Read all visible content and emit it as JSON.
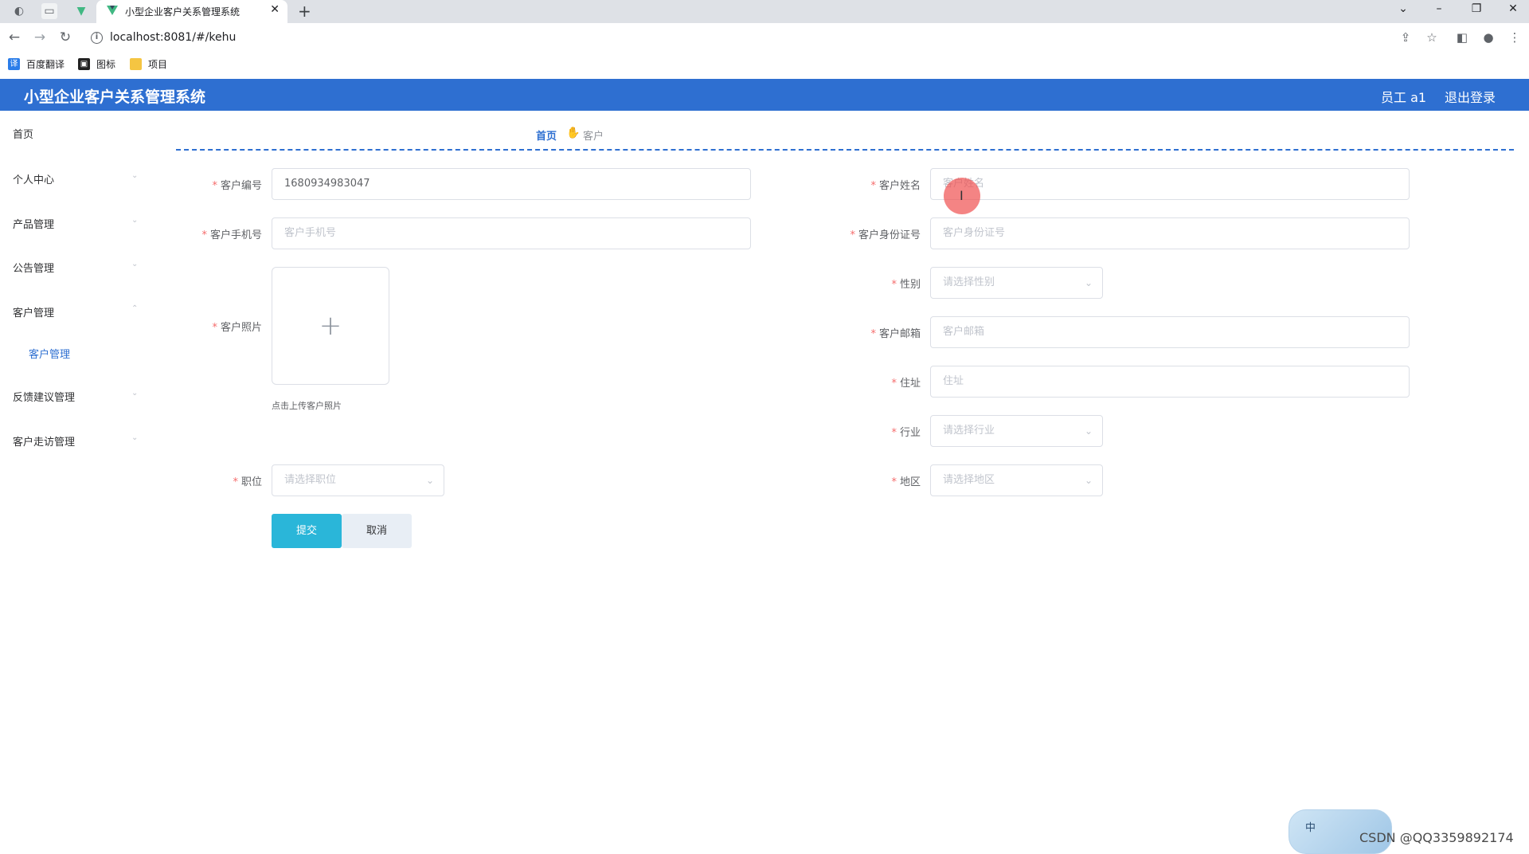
{
  "browser": {
    "tab_title": "小型企业客户关系管理系统",
    "url": "localhost:8081/#/kehu",
    "bookmarks": [
      "百度翻译",
      "图标",
      "项目"
    ]
  },
  "header": {
    "title": "小型企业客户关系管理系统",
    "user": "员工 a1",
    "logout": "退出登录"
  },
  "sidebar": {
    "items": [
      {
        "label": "首页"
      },
      {
        "label": "个人中心"
      },
      {
        "label": "产品管理"
      },
      {
        "label": "公告管理"
      },
      {
        "label": "客户管理"
      },
      {
        "label": "反馈建议管理"
      },
      {
        "label": "客户走访管理"
      }
    ],
    "active_sub": "客户管理"
  },
  "breadcrumb": {
    "home": "首页",
    "current": "客户"
  },
  "form": {
    "customer_no": {
      "label": "客户编号",
      "value": "1680934983047"
    },
    "customer_name": {
      "label": "客户姓名",
      "placeholder": "客户姓名"
    },
    "customer_phone": {
      "label": "客户手机号",
      "placeholder": "客户手机号"
    },
    "customer_id": {
      "label": "客户身份证号",
      "placeholder": "客户身份证号"
    },
    "gender": {
      "label": "性别",
      "placeholder": "请选择性别"
    },
    "photo": {
      "label": "客户照片",
      "tip": "点击上传客户照片"
    },
    "email": {
      "label": "客户邮箱",
      "placeholder": "客户邮箱"
    },
    "address": {
      "label": "住址",
      "placeholder": "住址"
    },
    "industry": {
      "label": "行业",
      "placeholder": "请选择行业"
    },
    "position": {
      "label": "职位",
      "placeholder": "请选择职位"
    },
    "region": {
      "label": "地区",
      "placeholder": "请选择地区"
    },
    "submit": "提交",
    "cancel": "取消"
  },
  "ime": {
    "label": "中"
  },
  "watermark": "CSDN @QQ3359892174"
}
